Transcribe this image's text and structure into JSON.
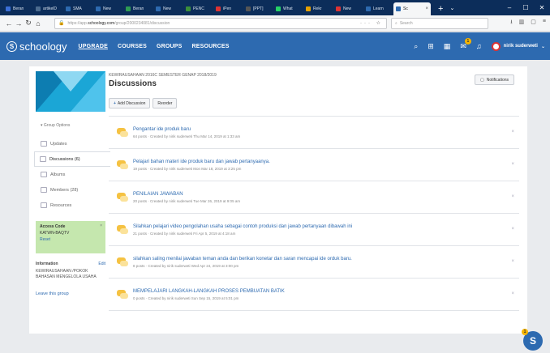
{
  "browser": {
    "tabs": [
      {
        "label": "Beran",
        "color": "#3a6fd8"
      },
      {
        "label": "artikelD",
        "color": "#4b6b8f"
      },
      {
        "label": "SMA",
        "color": "#2d6ab0"
      },
      {
        "label": "New",
        "color": "#2d6ab0"
      },
      {
        "label": "Beran",
        "color": "#2e9c53"
      },
      {
        "label": "New",
        "color": "#2d6ab0"
      },
      {
        "label": "PENC",
        "color": "#3b8f3b"
      },
      {
        "label": "iPen",
        "color": "#d33"
      },
      {
        "label": "[PPT]",
        "color": "#555"
      },
      {
        "label": "What",
        "color": "#25d366"
      },
      {
        "label": "Rekr",
        "color": "#e6a100"
      },
      {
        "label": "New",
        "color": "#d33"
      },
      {
        "label": "Learn",
        "color": "#2d6ab0"
      }
    ],
    "active_tab": {
      "label": "Sc",
      "color": "#2d6ab0"
    },
    "url_prefix": "https://app.",
    "url_host": "schoology.com",
    "url_path": "/group/2000234081/discussion",
    "search_placeholder": "Search"
  },
  "appbar": {
    "logo": "schoology",
    "nav": [
      "UPGRADE",
      "COURSES",
      "GROUPS",
      "RESOURCES"
    ],
    "message_count": "1",
    "user_name": "nirik suderweti"
  },
  "sidebar": {
    "group_options": "Group Options",
    "items": [
      {
        "label": "Updates",
        "active": false
      },
      {
        "label": "Discussions (6)",
        "active": true
      },
      {
        "label": "Albums",
        "active": false
      },
      {
        "label": "Members (28)",
        "active": false
      },
      {
        "label": "Resources",
        "active": false
      }
    ],
    "access_title": "Access Code",
    "access_code": "KATWN-BAQTV",
    "access_reset": "Reset",
    "info_title": "Information",
    "info_edit": "Edit",
    "info_body": "KEWIRAUSAHAAN /POKOK BAHASAN MENGELOLA USAHA",
    "leave": "Leave this group"
  },
  "main": {
    "breadcrumb": "KEWIRAUSAHAAN 2016C SEMESTER GENAP 2018/2019",
    "title": "Discussions",
    "notifications": "Notifications",
    "add_discussion": "Add Discussion",
    "reorder": "Reorder",
    "discussions": [
      {
        "title": "Pengantar ide produk baru",
        "meta": "64 posts · Created by nirik suderweti Thu Mar 14, 2019 at 1:33 am"
      },
      {
        "title": "Pelajari bahan materi ide produk baru dan jawab pertanyaanya.",
        "meta": "19 posts · Created by nirik suderweti Mon Mar 18, 2019 at 3:25 pm"
      },
      {
        "title": "PENILAIAN JAWABAN",
        "meta": "20 posts · Created by nirik suderweti Tue Mar 26, 2019 at 9:05 am"
      },
      {
        "title": "Silahkan pelajari video pengolahan usaha sebagai contoh produksi dan jawab pertanyaan dibawah ini",
        "meta": "21 posts · Created by nirik suderweti Fri Apr 5, 2019 at 4:18 am"
      },
      {
        "title": "silahkan saling menilai jawaban teman anda dan berikan konetar dan saran mencapai ide orduk baru.",
        "meta": "8 posts · Created by nirik suderweti Wed Apr 24, 2019 at 3:00 pm"
      },
      {
        "title": "MEMPELAJARI LANGKAH-LANGKAH PROSES PEMBUATAN BATIK",
        "meta": "0 posts · Created by nirik suderweti Sun Sep 15, 2019 at 5:01 pm"
      }
    ]
  },
  "fab": {
    "letter": "S",
    "count": "1"
  }
}
